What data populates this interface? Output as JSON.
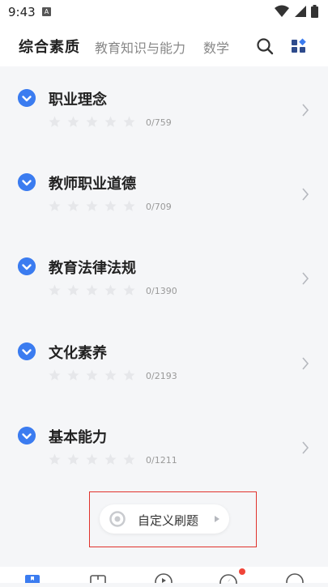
{
  "status": {
    "time": "9:43",
    "badge": "A"
  },
  "tabs": [
    {
      "label": "综合素质",
      "active": true
    },
    {
      "label": "教育知识与能力",
      "active": false
    },
    {
      "label": "数学",
      "active": false
    }
  ],
  "subjects": [
    {
      "title": "职业理念",
      "progress": "0/759"
    },
    {
      "title": "教师职业道德",
      "progress": "0/709"
    },
    {
      "title": "教育法律法规",
      "progress": "0/1390"
    },
    {
      "title": "文化素养",
      "progress": "0/2193"
    },
    {
      "title": "基本能力",
      "progress": "0/1211"
    }
  ],
  "custom": {
    "label": "自定义刷题"
  },
  "colors": {
    "accent": "#3b7cf0",
    "highlight_box": "#e0322c",
    "notification_dot": "#f04438"
  }
}
